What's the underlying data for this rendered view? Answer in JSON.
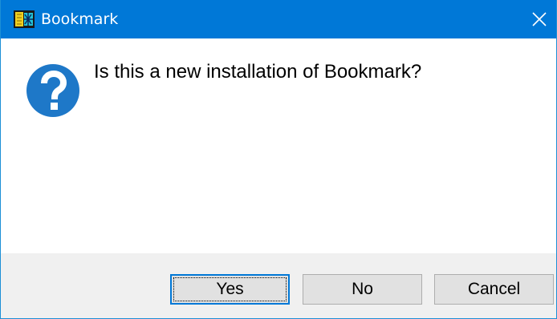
{
  "window": {
    "title": "Bookmark",
    "app_icon": "bookmark-app-icon",
    "close_icon": "close-icon"
  },
  "dialog": {
    "icon": "question-icon",
    "message": "Is this a new installation of Bookmark?"
  },
  "buttons": {
    "yes_label": "Yes",
    "no_label": "No",
    "cancel_label": "Cancel",
    "default": "Yes"
  },
  "colors": {
    "titlebar": "#0078d7",
    "question_icon": "#1e78c8",
    "button_face": "#e1e1e1",
    "footer": "#f0f0f0"
  }
}
